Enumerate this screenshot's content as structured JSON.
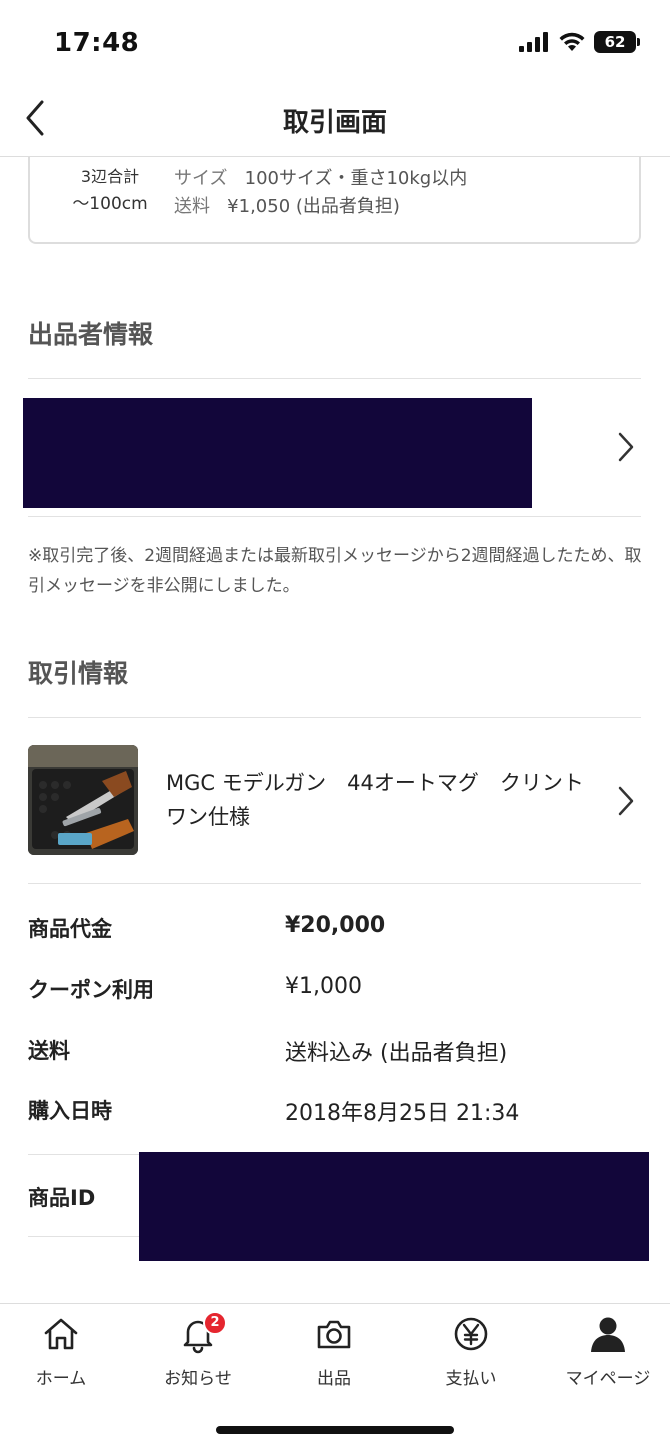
{
  "status_bar": {
    "time": "17:48",
    "battery": "62"
  },
  "nav": {
    "title": "取引画面"
  },
  "shipping": {
    "size_label": "3辺合計",
    "size_range": "〜100cm",
    "size_key": "サイズ",
    "size_value": "100サイズ・重さ10kg以内",
    "fee_key": "送料",
    "fee_value": "¥1,050 (出品者負担)"
  },
  "seller": {
    "heading": "出品者情報"
  },
  "notice": "※取引完了後、2週間経過または最新取引メッセージから2週間経過したため、取引メッセージを非公開にしました。",
  "transaction": {
    "heading": "取引情報",
    "item_name": "MGC モデルガン　44オートマグ　クリントワン仕様",
    "rows": [
      {
        "label": "商品代金",
        "value": "¥20,000"
      },
      {
        "label": "クーポン利用",
        "value": "¥1,000"
      },
      {
        "label": "送料",
        "value": "送料込み (出品者負担)"
      },
      {
        "label": "購入日時",
        "value": "2018年8月25日 21:34"
      },
      {
        "label": "商品ID",
        "value": ""
      }
    ]
  },
  "tabs": [
    {
      "label": "ホーム",
      "icon": "home-icon"
    },
    {
      "label": "お知らせ",
      "icon": "bell-icon",
      "badge": "2"
    },
    {
      "label": "出品",
      "icon": "camera-icon"
    },
    {
      "label": "支払い",
      "icon": "yen-circle-icon"
    },
    {
      "label": "マイページ",
      "icon": "person-icon"
    }
  ],
  "colors": {
    "badge": "#e5262f",
    "redaction": "#12063a"
  }
}
